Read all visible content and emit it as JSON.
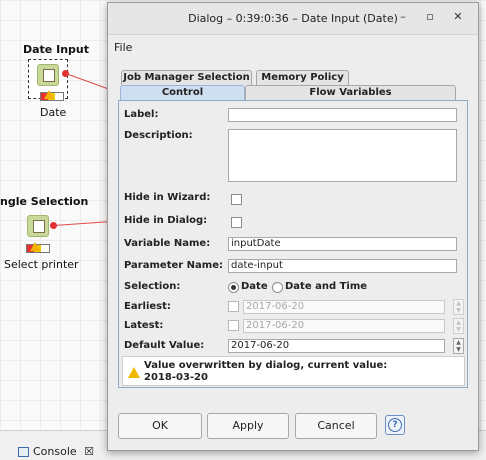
{
  "workflow": {
    "nodes": [
      {
        "title": "Date Input",
        "label": "Date"
      },
      {
        "title": "ngle Selection",
        "label": "Select printer"
      }
    ],
    "colors": {
      "port": "#e03030",
      "connection": "#e04a4a",
      "node_icon": "#c9d99a"
    },
    "icons": [
      "date-input-node-icon",
      "single-selection-node-icon",
      "warning-icon"
    ]
  },
  "bottom_panel": {
    "console_label": "Console",
    "close_glyph": "☒"
  },
  "dialog": {
    "title": "Dialog – 0:39:0:36 – Date Input (Date)",
    "window_controls": {
      "minimize": "–",
      "maximize": "▫",
      "close": "✕"
    },
    "menu": {
      "file": "File"
    },
    "tabs_back": [
      "Job Manager Selection",
      "Memory Policy"
    ],
    "tabs_front": [
      "Control",
      "Flow Variables"
    ],
    "active_tab": "Control",
    "form": {
      "label_label": "Label:",
      "label_value": "",
      "description_label": "Description:",
      "description_value": "",
      "hide_wizard_label": "Hide in Wizard:",
      "hide_wizard_checked": false,
      "hide_dialog_label": "Hide in Dialog:",
      "hide_dialog_checked": false,
      "variable_name_label": "Variable Name:",
      "variable_name_value": "inputDate",
      "parameter_name_label": "Parameter Name:",
      "parameter_name_value": "date-input",
      "selection_label": "Selection:",
      "selection_options": [
        "Date",
        "Date and Time"
      ],
      "selection_value": "Date",
      "earliest_label": "Earliest:",
      "earliest_value": "2017-06-20",
      "latest_label": "Latest:",
      "latest_value": "2017-06-20",
      "default_value_label": "Default Value:",
      "default_value": "2017-06-20",
      "warning_line1": "Value overwritten by dialog, current value:",
      "warning_line2": "2018-03-20"
    },
    "buttons": {
      "ok": "OK",
      "apply": "Apply",
      "cancel": "Cancel",
      "help": "?"
    }
  }
}
